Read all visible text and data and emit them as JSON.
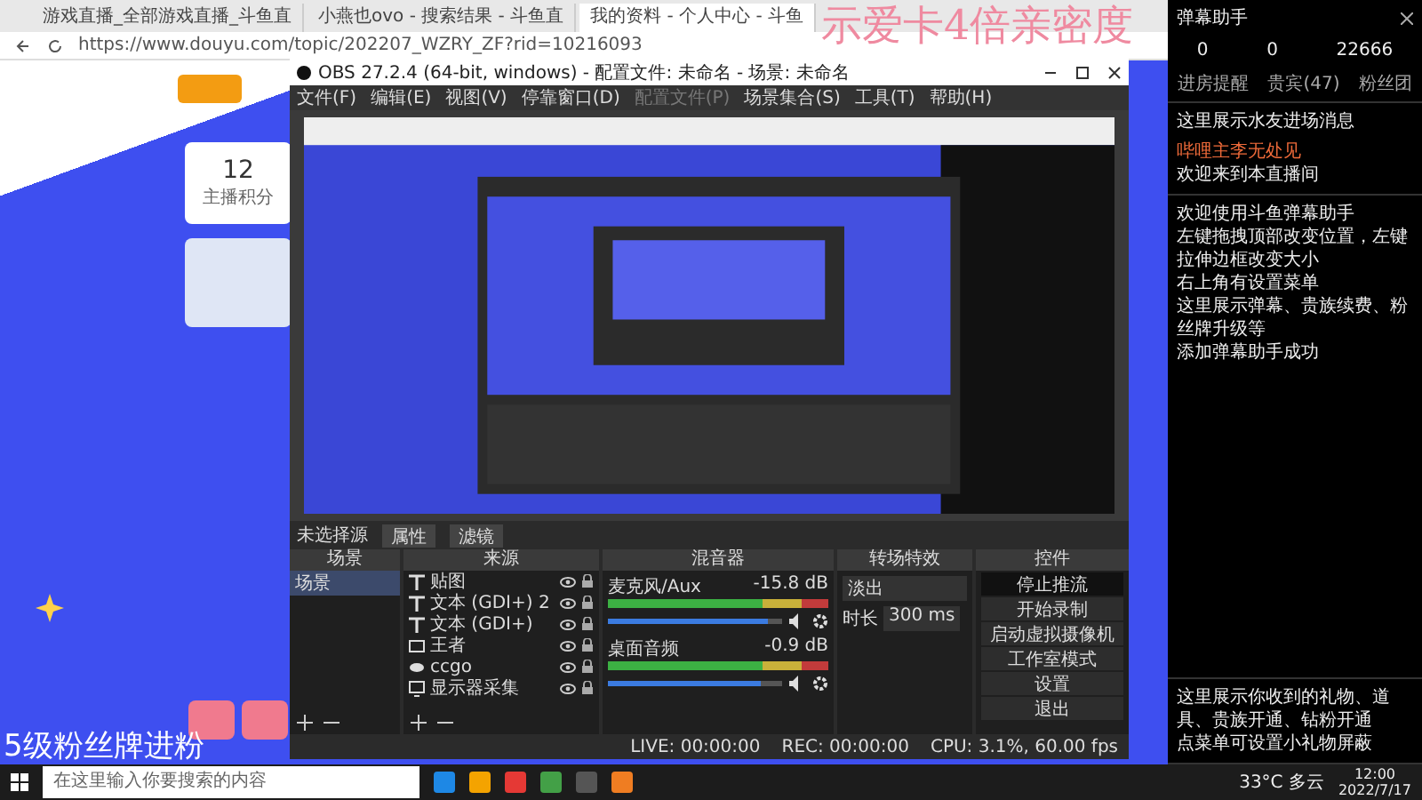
{
  "browser": {
    "tabs": [
      {
        "label": "游戏直播_全部游戏直播_斗鱼直",
        "selected": false
      },
      {
        "label": "小燕也ovo - 搜索结果 - 斗鱼直",
        "selected": false
      },
      {
        "label": "我的资料 - 个人中心 - 斗鱼",
        "selected": true
      }
    ],
    "url": "https://www.douyu.com/topic/202207_WZRY_ZF?rid=10216093",
    "page": {
      "stat_value": "12",
      "stat_label": "主播积分"
    }
  },
  "overlays": {
    "gift_banner": "示爱卡4倍亲密度",
    "fan_banner": "5级粉丝牌进粉"
  },
  "obs": {
    "title": "OBS 27.2.4 (64-bit, windows) - 配置文件: 未命名 - 场景: 未命名",
    "menus": [
      {
        "label": "文件(F)",
        "disabled": false
      },
      {
        "label": "编辑(E)",
        "disabled": false
      },
      {
        "label": "视图(V)",
        "disabled": false
      },
      {
        "label": "停靠窗口(D)",
        "disabled": false
      },
      {
        "label": "配置文件(P)",
        "disabled": true
      },
      {
        "label": "场景集合(S)",
        "disabled": false
      },
      {
        "label": "工具(T)",
        "disabled": false
      },
      {
        "label": "帮助(H)",
        "disabled": false
      }
    ],
    "no_source_label": "未选择源",
    "source_buttons": [
      "属性",
      "滤镜"
    ],
    "scenes": {
      "title": "场景",
      "items": [
        {
          "label": "场景",
          "selected": true
        }
      ]
    },
    "sources": {
      "title": "来源",
      "items": [
        {
          "kind": "text",
          "name": "贴图"
        },
        {
          "kind": "text",
          "name": "文本 (GDI+) 2"
        },
        {
          "kind": "text",
          "name": "文本 (GDI+)"
        },
        {
          "kind": "window",
          "name": "王者"
        },
        {
          "kind": "game",
          "name": "ccgo"
        },
        {
          "kind": "display",
          "name": "显示器采集"
        }
      ]
    },
    "mixer": {
      "title": "混音器",
      "channels": [
        {
          "name": "麦克风/Aux",
          "reading": "-15.8 dB",
          "level": 0.92
        },
        {
          "name": "桌面音频",
          "reading": "-0.9 dB",
          "level": 0.88
        }
      ]
    },
    "transitions": {
      "title": "转场特效",
      "type": "淡出",
      "duration_label": "时长",
      "duration": "300 ms"
    },
    "controls": {
      "title": "控件",
      "buttons": [
        {
          "label": "停止推流",
          "active": true
        },
        {
          "label": "开始录制",
          "active": false
        },
        {
          "label": "启动虚拟摄像机",
          "active": false
        },
        {
          "label": "工作室模式",
          "active": false
        },
        {
          "label": "设置",
          "active": false
        },
        {
          "label": "退出",
          "active": false
        }
      ]
    },
    "status": [
      "LIVE: 00:00:00",
      "REC: 00:00:00",
      "CPU: 3.1%, 60.00 fps"
    ]
  },
  "danmaku": {
    "title": "弹幕助手",
    "stats": [
      "0",
      "0",
      "22666"
    ],
    "tabs": [
      "进房提醒",
      "贵宾(47)",
      "粉丝团"
    ],
    "entry_hint": "这里展示水友进场消息",
    "entry": {
      "user": "哔哩主李无处见",
      "text": "欢迎来到本直播间"
    },
    "messages": [
      "欢迎使用斗鱼弹幕助手",
      "左键拖拽顶部改变位置，左键拉伸边框改变大小",
      "右上角有设置菜单",
      "这里展示弹幕、贵族续费、粉丝牌升级等",
      "添加弹幕助手成功"
    ],
    "gift_lines": [
      "这里展示你收到的礼物、道具、贵族开通、钻粉开通",
      "点菜单可设置小礼物屏蔽"
    ]
  },
  "taskbar": {
    "search_placeholder": "在这里输入你要搜索的内容",
    "weather": "33°C 多云",
    "time": "12:00",
    "date": "2022/7/17"
  }
}
